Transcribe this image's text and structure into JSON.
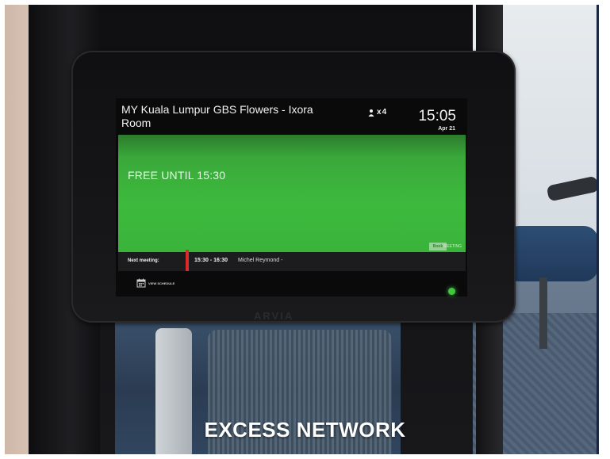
{
  "room_display": {
    "room_name": "MY Kuala Lumpur GBS Flowers - Ixora Room",
    "capacity_prefix": "x",
    "capacity": "4",
    "time": "15:05",
    "date": "Apr 21",
    "status": "FREE UNTIL 15:30",
    "next_meeting": {
      "label": "Next meeting:",
      "time_range": "15:30 - 16:30",
      "organizer": "Michel Reymond -"
    },
    "schedule_link": "VIEW SCHEDULE",
    "book_label": "Book",
    "book_sub": "MEETING",
    "status_color": "#3dba3d",
    "accent_color": "#d92b2b"
  },
  "device_brand": "ARVIA",
  "watermark": "EXCESS NETWORK",
  "icons": {
    "capacity": "person-icon",
    "schedule": "calendar-icon"
  }
}
